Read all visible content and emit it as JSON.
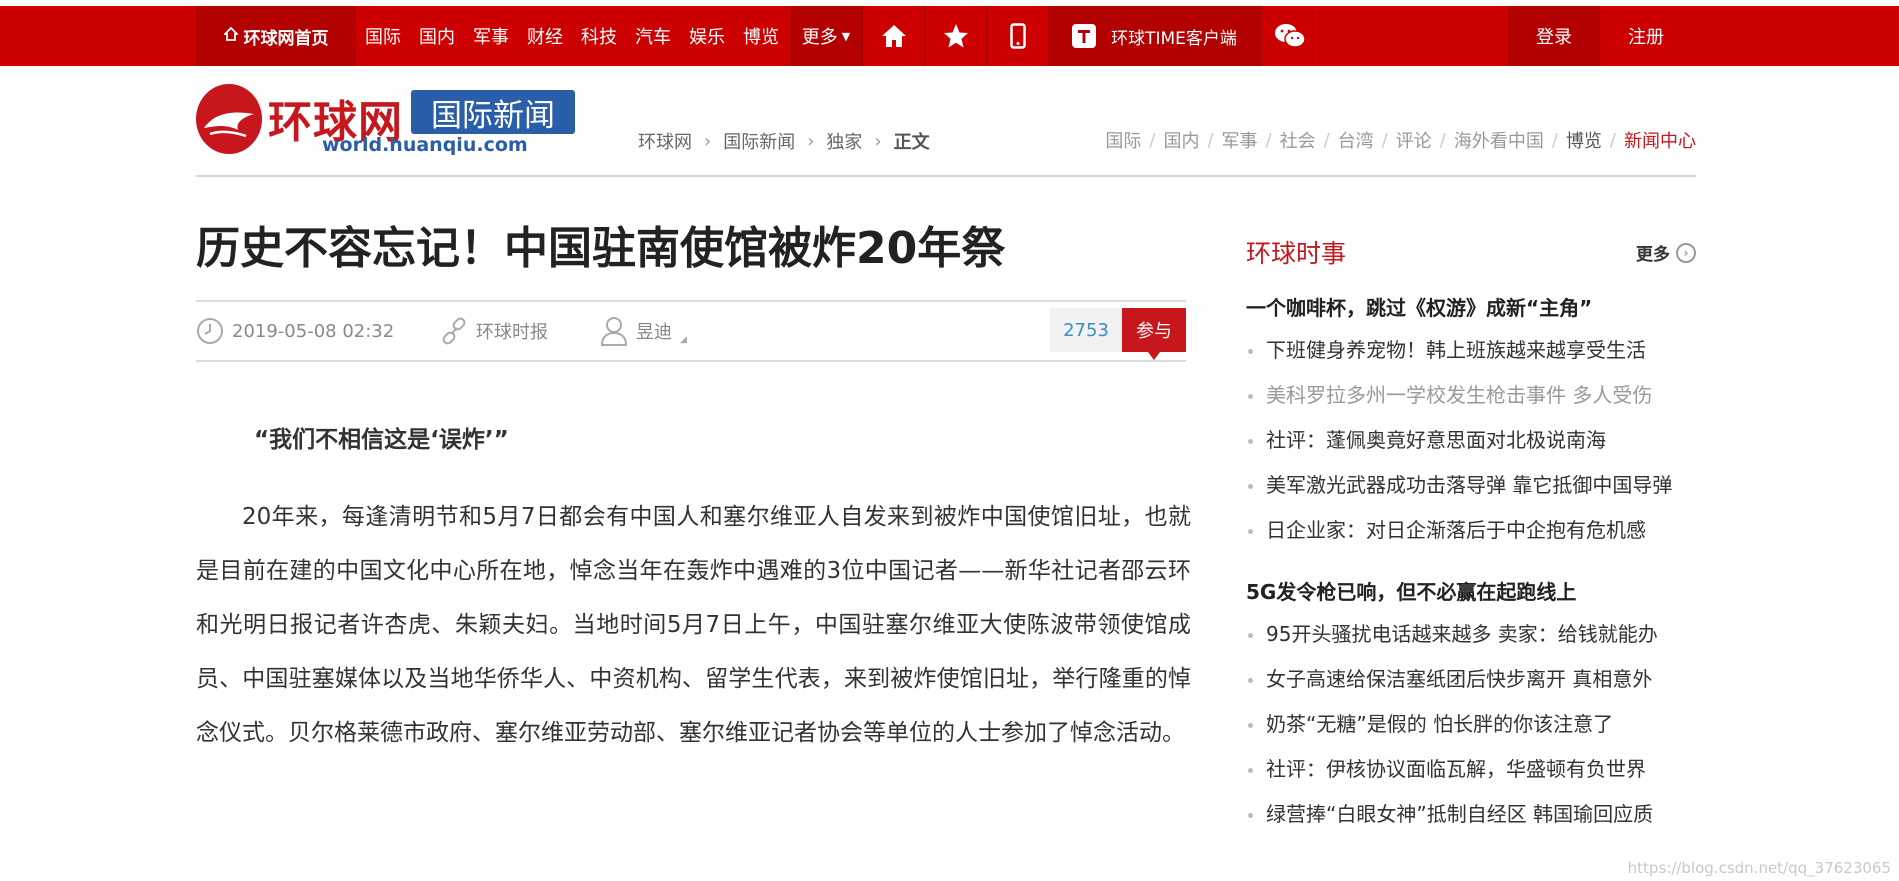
{
  "topnav": {
    "home": "环球网首页",
    "links": [
      "国际",
      "国内",
      "军事",
      "财经",
      "科技",
      "汽车",
      "娱乐",
      "博览"
    ],
    "more": "更多",
    "app": "环球TIME客户端",
    "login": "登录",
    "register": "注册"
  },
  "header": {
    "brand": "环球网",
    "channel": "国际新闻",
    "url": "world.huanqiu.com",
    "breadcrumb": [
      "环球网",
      "国际新闻",
      "独家",
      "正文"
    ],
    "subnav": [
      "国际",
      "国内",
      "军事",
      "社会",
      "台湾",
      "评论",
      "海外看中国",
      "博览",
      "新闻中心"
    ]
  },
  "article": {
    "title": "历史不容忘记！中国驻南使馆被炸20年祭",
    "date": "2019-05-08 02:32",
    "source": "环球时报",
    "author": "昱迪",
    "comment_count": "2753",
    "join_label": "参与",
    "quote": "“我们不相信这是‘误炸’”",
    "paragraph": "20年来，每逢清明节和5月7日都会有中国人和塞尔维亚人自发来到被炸中国使馆旧址，也就是目前在建的中国文化中心所在地，悼念当年在轰炸中遇难的3位中国记者——新华社记者邵云环和光明日报记者许杏虎、朱颖夫妇。当地时间5月7日上午，中国驻塞尔维亚大使陈波带领使馆成员、中国驻塞媒体以及当地华侨华人、中资机构、留学生代表，来到被炸使馆旧址，举行隆重的悼念仪式。贝尔格莱德市政府、塞尔维亚劳动部、塞尔维亚记者协会等单位的人士参加了悼念活动。"
  },
  "sidebar": {
    "title": "环球时事",
    "more": "更多",
    "groups": [
      {
        "headline": "一个咖啡杯，跳过《权游》成新“主角”",
        "items": [
          "下班健身养宠物！韩上班族越来越享受生活",
          "美科罗拉多州一学校发生枪击事件 多人受伤",
          "社评：蓬佩奥竟好意思面对北极说南海",
          "美军激光武器成功击落导弹 靠它抵御中国导弹",
          "日企业家：对日企渐落后于中企抱有危机感"
        ]
      },
      {
        "headline": "5G发令枪已响，但不必赢在起跑线上",
        "items": [
          "95开头骚扰电话越来越多 卖家：给钱就能办",
          "女子高速给保洁塞纸团后快步离开 真相意外",
          "奶茶“无糖”是假的 怕长胖的你该注意了",
          "社评：伊核协议面临瓦解，华盛顿有负世界",
          "绿营捧“白眼女神”抵制自经区 韩国瑜回应质"
        ]
      }
    ]
  },
  "watermark": "https://blog.csdn.net/qq_37623065",
  "colors": {
    "brand_red": "#cc0000",
    "dark_red": "#b30000",
    "blue": "#2b5ea8",
    "link_blue": "#3b8ec2"
  }
}
